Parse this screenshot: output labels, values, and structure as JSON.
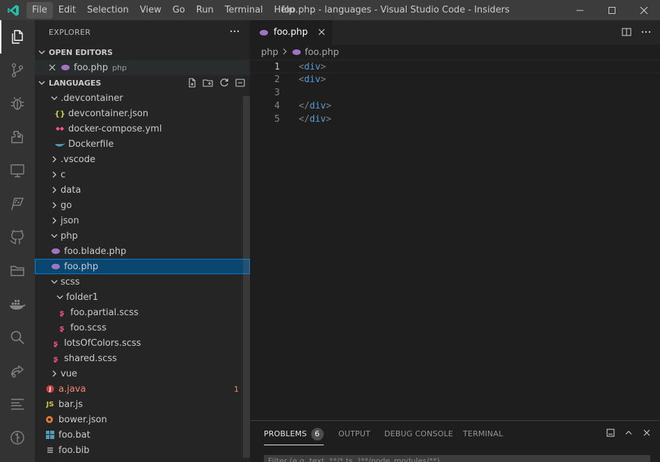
{
  "titlebar": {
    "menu": [
      "File",
      "Edit",
      "Selection",
      "View",
      "Go",
      "Run",
      "Terminal",
      "Help"
    ],
    "title": "foo.php - languages - Visual Studio Code - Insiders"
  },
  "activity": [
    "explorer-icon",
    "source-control-icon",
    "debug-icon",
    "extensions-icon",
    "remote-explorer-icon",
    "testing-icon",
    "github-icon",
    "folder-icon",
    "docker-icon",
    "search-icon",
    "live-share-icon",
    "outline-icon",
    "timeline-icon"
  ],
  "sidebar": {
    "title": "EXPLORER",
    "open_editors_label": "OPEN EDITORS",
    "open_editor": {
      "name": "foo.php",
      "lang": "php"
    },
    "workspace_label": "LANGUAGES",
    "tree": [
      {
        "label": ".devcontainer",
        "type": "folder-open"
      },
      {
        "label": "devcontainer.json",
        "type": "json"
      },
      {
        "label": "docker-compose.yml",
        "type": "yaml"
      },
      {
        "label": "Dockerfile",
        "type": "docker"
      },
      {
        "label": ".vscode",
        "type": "folder"
      },
      {
        "label": "c",
        "type": "folder"
      },
      {
        "label": "data",
        "type": "folder"
      },
      {
        "label": "go",
        "type": "folder"
      },
      {
        "label": "json",
        "type": "folder"
      },
      {
        "label": "php",
        "type": "folder-open"
      },
      {
        "label": "foo.blade.php",
        "type": "php"
      },
      {
        "label": "foo.php",
        "type": "php"
      },
      {
        "label": "scss",
        "type": "folder-open"
      },
      {
        "label": "folder1",
        "type": "folder-open"
      },
      {
        "label": "foo.partial.scss",
        "type": "scss"
      },
      {
        "label": "foo.scss",
        "type": "scss"
      },
      {
        "label": "lotsOfColors.scss",
        "type": "scss"
      },
      {
        "label": "shared.scss",
        "type": "scss"
      },
      {
        "label": "vue",
        "type": "folder"
      },
      {
        "label": "a.java",
        "type": "java",
        "badge": "1"
      },
      {
        "label": "bar.js",
        "type": "js"
      },
      {
        "label": "bower.json",
        "type": "bower"
      },
      {
        "label": "foo.bat",
        "type": "bat"
      },
      {
        "label": "foo.bib",
        "type": "bib"
      }
    ]
  },
  "editor": {
    "tab": "foo.php",
    "breadcrumb": [
      "php",
      "foo.php"
    ],
    "lines": [
      {
        "num": "1",
        "open": "<",
        "tag": "div",
        "close": ">"
      },
      {
        "num": "2",
        "open": "<",
        "tag": "div",
        "close": ">"
      },
      {
        "num": "3",
        "open": "",
        "tag": "",
        "close": ""
      },
      {
        "num": "4",
        "open": "</",
        "tag": "div",
        "close": ">"
      },
      {
        "num": "5",
        "open": "</",
        "tag": "div",
        "close": ">"
      }
    ]
  },
  "panel": {
    "tabs": [
      "PROBLEMS",
      "OUTPUT",
      "DEBUG CONSOLE",
      "TERMINAL"
    ],
    "problems_count": "6",
    "filter_placeholder": "Filter (e.g. text, **/*.ts, !**/node_modules/**)"
  },
  "colors": {
    "accent": "#007fd4",
    "selection": "#094771",
    "php": "#a074c4",
    "scss": "#f55385",
    "java": "#cc3e44",
    "js": "#cbcb41",
    "docker": "#519aba"
  }
}
